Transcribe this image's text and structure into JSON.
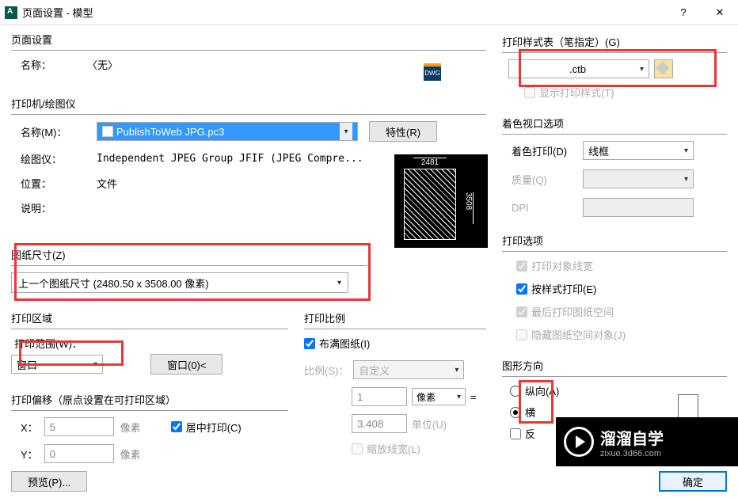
{
  "titlebar": {
    "title": "页面设置 - 模型",
    "help": "?",
    "close": "✕"
  },
  "pageSetup": {
    "title": "页面设置",
    "nameLabel": "名称：",
    "nameValue": "〈无〉",
    "dwg": "DWG"
  },
  "printer": {
    "title": "打印机/绘图仪",
    "nameLabel": "名称(M)：",
    "nameValue": "PublishToWeb JPG.pc3",
    "propsBtn": "特性(R)",
    "plotterLabel": "绘图仪：",
    "plotterValue": "Independent JPEG Group JFIF (JPEG Compre...",
    "locationLabel": "位置：",
    "locationValue": "文件",
    "descLabel": "说明：",
    "preview": {
      "w": "2481",
      "h": "3508"
    }
  },
  "paper": {
    "title": "图纸尺寸(Z)",
    "value": "上一个图纸尺寸  (2480.50 x 3508.00 像素)"
  },
  "area": {
    "title": "打印区域",
    "rangeLabel": "打印范围(W)：",
    "rangeValue": "窗口",
    "windowBtn": "窗口(0)<"
  },
  "scale": {
    "title": "打印比例",
    "fitCheck": "布满图纸(I)",
    "scaleLabel": "比例(S)：",
    "scaleValue": "自定义",
    "num": "1",
    "pxUnit": "像素",
    "eq": "=",
    "denom": "3.408",
    "unitLabel": "单位(U)",
    "lineweight": "缩放线宽(L)"
  },
  "offset": {
    "title": "打印偏移（原点设置在可打印区域）",
    "x": "X：",
    "xval": "5",
    "xunit": "像素",
    "y": "Y：",
    "yval": "0",
    "yunit": "像素",
    "center": "居中打印(C)"
  },
  "styleTable": {
    "title": "打印样式表（笔指定）(G)",
    "ctb": ".ctb",
    "display": "显示打印样式(T)"
  },
  "shade": {
    "title": "着色视口选项",
    "shadeLabel": "着色打印(D)",
    "shadeValue": "线框",
    "qualityLabel": "质量(Q)",
    "dpiLabel": "DPI"
  },
  "options": {
    "title": "打印选项",
    "o1": "打印对象线宽",
    "o2": "按样式打印(E)",
    "o3": "最后打印图纸空间",
    "o4": "隐藏图纸空间对象(J)"
  },
  "orientation": {
    "title": "图形方向",
    "portrait": "纵向(A)",
    "landscape": "横",
    "reverse": "反"
  },
  "footer": {
    "preview": "预览(P)...",
    "ok": "确定"
  },
  "watermark": {
    "big": "溜溜自学",
    "small": "zixue.3d66.com"
  }
}
